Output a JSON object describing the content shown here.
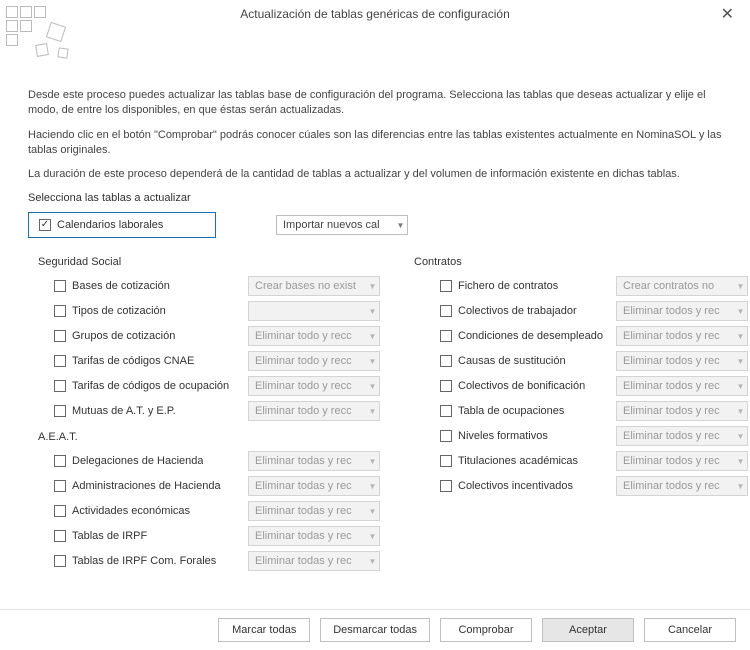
{
  "window": {
    "title": "Actualización de tablas genéricas de configuración"
  },
  "intro": {
    "p1": "Desde este proceso puedes actualizar las tablas base de configuración del programa. Selecciona las tablas que deseas actualizar y elije el modo, de entre los disponibles, en que éstas serán actualizadas.",
    "p2": "Haciendo clic en el botón \"Comprobar\" podrás conocer cúales son las diferencias entre las tablas existentes actualmente en NominaSOL y las tablas originales.",
    "p3": "La duración de este proceso dependerá de la cantidad de tablas a actualizar y del volumen de información existente en dichas tablas.",
    "select_label": "Selecciona las tablas a actualizar"
  },
  "top": {
    "calendarios_label": "Calendarios laborales",
    "calendarios_checked": true,
    "calendarios_combo": "Importar nuevos cal"
  },
  "groups": {
    "seguridad_title": "Seguridad Social",
    "aeat_title": "A.E.A.T.",
    "contratos_title": "Contratos"
  },
  "seguridad": [
    {
      "label": "Bases de cotización",
      "combo": "Crear bases no exist"
    },
    {
      "label": "Tipos de cotización",
      "combo": ""
    },
    {
      "label": "Grupos de cotización",
      "combo": "Eliminar todo y recc"
    },
    {
      "label": "Tarifas de códigos CNAE",
      "combo": "Eliminar todo y recc"
    },
    {
      "label": "Tarifas de códigos de ocupación",
      "combo": "Eliminar todo y recc"
    },
    {
      "label": "Mutuas de A.T. y E.P.",
      "combo": "Eliminar todo y recc"
    }
  ],
  "aeat": [
    {
      "label": "Delegaciones de Hacienda",
      "combo": "Eliminar todas y rec"
    },
    {
      "label": "Administraciones de Hacienda",
      "combo": "Eliminar todas y rec"
    },
    {
      "label": "Actividades económicas",
      "combo": "Eliminar todas y rec"
    },
    {
      "label": "Tablas de IRPF",
      "combo": "Eliminar todas y rec"
    },
    {
      "label": "Tablas de IRPF Com. Forales",
      "combo": "Eliminar todas y rec"
    }
  ],
  "contratos": [
    {
      "label": "Fichero de contratos",
      "combo": "Crear contratos no"
    },
    {
      "label": "Colectivos de trabajador",
      "combo": "Eliminar todos y rec"
    },
    {
      "label": "Condiciones de desempleado",
      "combo": "Eliminar todos y rec"
    },
    {
      "label": "Causas de sustitución",
      "combo": "Eliminar todos y rec"
    },
    {
      "label": "Colectivos de bonificación",
      "combo": "Eliminar todos y rec"
    },
    {
      "label": "Tabla de ocupaciones",
      "combo": "Eliminar todos y rec"
    },
    {
      "label": "Niveles formativos",
      "combo": "Eliminar todos y rec"
    },
    {
      "label": "Titulaciones académicas",
      "combo": "Eliminar todos y rec"
    },
    {
      "label": "Colectivos incentivados",
      "combo": "Eliminar todos y rec"
    }
  ],
  "footer": {
    "marcar": "Marcar todas",
    "desmarcar": "Desmarcar todas",
    "comprobar": "Comprobar",
    "aceptar": "Aceptar",
    "cancelar": "Cancelar"
  }
}
